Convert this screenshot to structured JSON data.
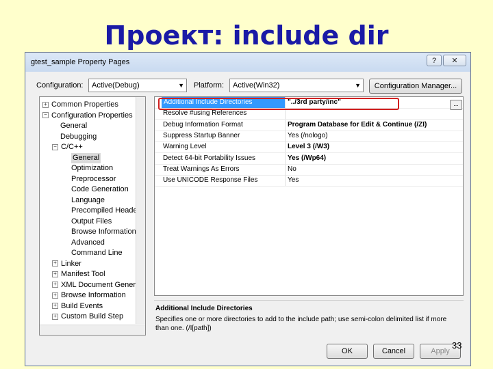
{
  "slide": {
    "title": "Проект: include dir",
    "page_number": "33"
  },
  "window": {
    "title": "gtest_sample Property Pages",
    "help_label": "?",
    "close_label": "✕"
  },
  "toolbar": {
    "configuration_label": "Configuration:",
    "configuration_value": "Active(Debug)",
    "platform_label": "Platform:",
    "platform_value": "Active(Win32)",
    "config_manager_label": "Configuration Manager..."
  },
  "tree": {
    "items": [
      {
        "label": "Common Properties",
        "expander": "+"
      },
      {
        "label": "Configuration Properties",
        "expander": "−"
      },
      {
        "label": "General"
      },
      {
        "label": "Debugging"
      },
      {
        "label": "C/C++",
        "expander": "−"
      },
      {
        "label": "General",
        "selected": true
      },
      {
        "label": "Optimization"
      },
      {
        "label": "Preprocessor"
      },
      {
        "label": "Code Generation"
      },
      {
        "label": "Language"
      },
      {
        "label": "Precompiled Heade"
      },
      {
        "label": "Output Files"
      },
      {
        "label": "Browse Information"
      },
      {
        "label": "Advanced"
      },
      {
        "label": "Command Line"
      },
      {
        "label": "Linker",
        "expander": "+"
      },
      {
        "label": "Manifest Tool",
        "expander": "+"
      },
      {
        "label": "XML Document Genera",
        "expander": "+"
      },
      {
        "label": "Browse Information",
        "expander": "+"
      },
      {
        "label": "Build Events",
        "expander": "+"
      },
      {
        "label": "Custom Build Step",
        "expander": "+"
      }
    ]
  },
  "properties": {
    "rows": [
      {
        "name": "Additional Include Directories",
        "value": "\"../3rd party/inc\"",
        "bold": true,
        "selected": true
      },
      {
        "name": "Resolve #using References",
        "value": "",
        "bold": false
      },
      {
        "name": "Debug Information Format",
        "value": "Program Database for Edit & Continue (/ZI)",
        "bold": true
      },
      {
        "name": "Suppress Startup Banner",
        "value": "Yes (/nologo)",
        "bold": false
      },
      {
        "name": "Warning Level",
        "value": "Level 3 (/W3)",
        "bold": true
      },
      {
        "name": "Detect 64-bit Portability Issues",
        "value": "Yes (/Wp64)",
        "bold": true
      },
      {
        "name": "Treat Warnings As Errors",
        "value": "No",
        "bold": false
      },
      {
        "name": "Use UNICODE Response Files",
        "value": "Yes",
        "bold": false
      }
    ],
    "ellipsis_label": "..."
  },
  "description": {
    "title": "Additional Include Directories",
    "text": "Specifies one or more directories to add to the include path; use semi-colon delimited list if more than one. (/I[path])"
  },
  "buttons": {
    "ok": "OK",
    "cancel": "Cancel",
    "apply": "Apply"
  },
  "colors": {
    "title": "#1a1aa6",
    "background": "#ffffcc",
    "highlight": "#d02020",
    "selection": "#3399ff"
  }
}
